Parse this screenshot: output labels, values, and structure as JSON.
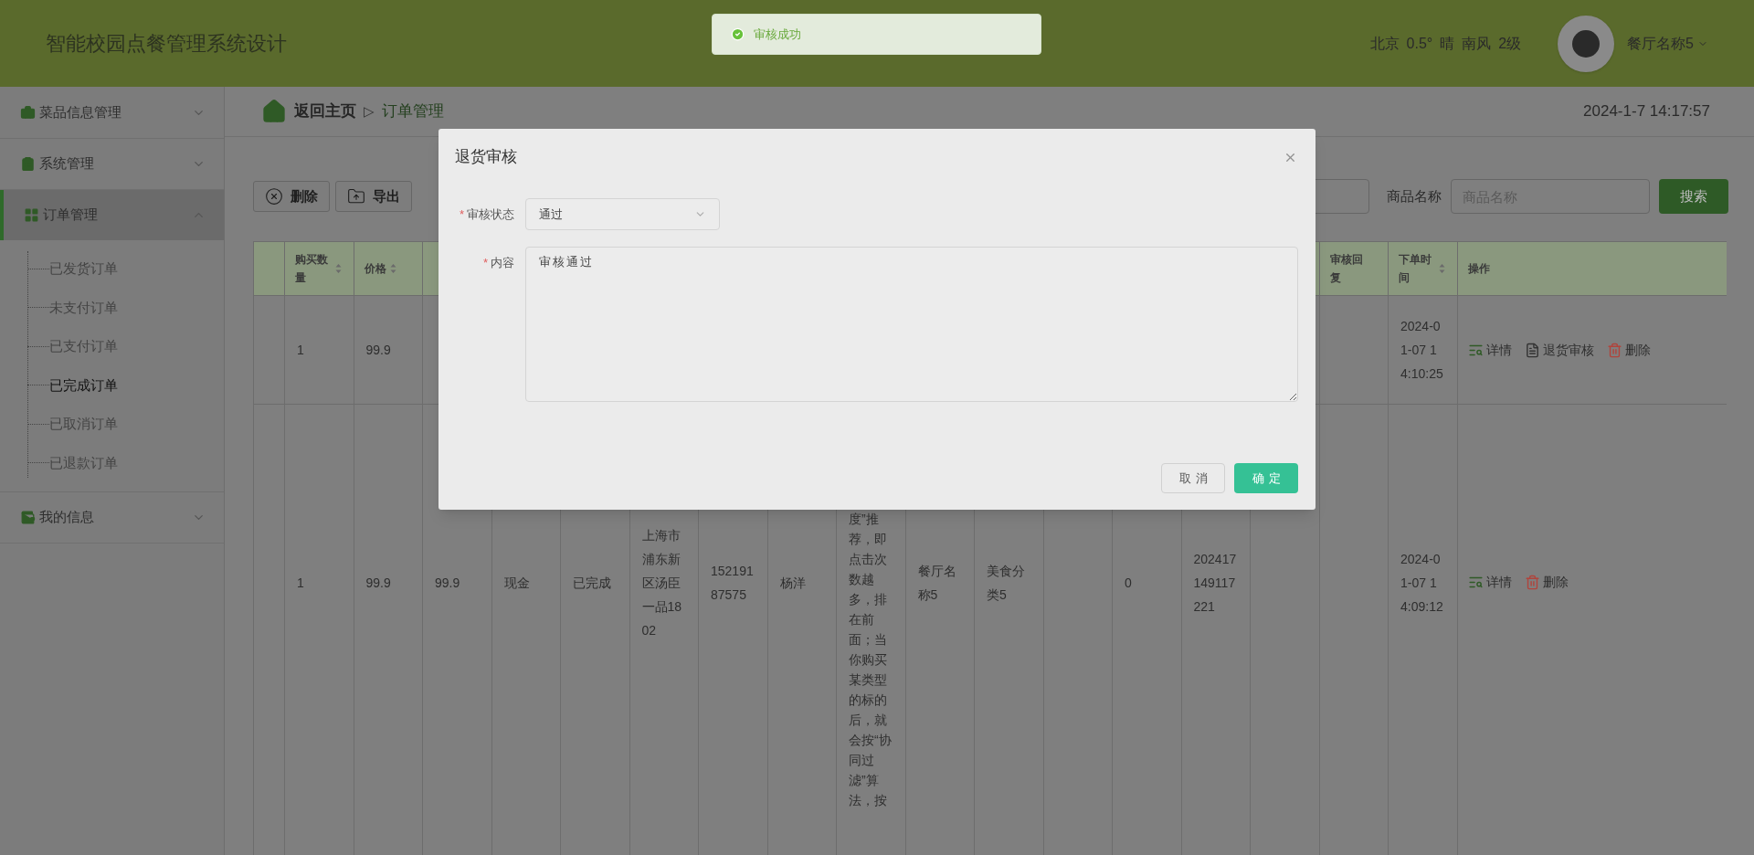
{
  "header": {
    "title": "智能校园点餐管理系统设计",
    "weather": [
      "北京",
      "0.5°",
      "晴",
      "南风",
      "2级"
    ],
    "user": "餐厅名称5"
  },
  "toast": {
    "text": "审核成功"
  },
  "sidebar": {
    "items": [
      {
        "label": "菜品信息管理",
        "expanded": false,
        "selected": false
      },
      {
        "label": "系统管理",
        "expanded": false,
        "selected": false
      },
      {
        "label": "订单管理",
        "expanded": true,
        "selected": true,
        "children": [
          {
            "label": "已发货订单",
            "selected": false
          },
          {
            "label": "未支付订单",
            "selected": false
          },
          {
            "label": "已支付订单",
            "selected": false
          },
          {
            "label": "已完成订单",
            "selected": true
          },
          {
            "label": "已取消订单",
            "selected": false
          },
          {
            "label": "已退款订单",
            "selected": false
          }
        ]
      },
      {
        "label": "我的信息",
        "expanded": false,
        "selected": false
      }
    ]
  },
  "breadcrumb": {
    "home": "返回主页",
    "separator": "▷",
    "current": "订单管理"
  },
  "clock": "2024-1-7 14:17:57",
  "toolbar": {
    "buttons": [
      {
        "kind": "delete",
        "label": "删除"
      },
      {
        "kind": "export",
        "label": "导出"
      }
    ]
  },
  "search": {
    "label": "商品名称",
    "placeholder": "商品名称",
    "button": "搜索"
  },
  "table": {
    "columns": [
      {
        "label": "购买数量",
        "sortable": true
      },
      {
        "label": "价格",
        "sortable": true
      },
      null,
      null,
      null,
      null,
      null,
      null,
      null,
      null,
      null,
      null,
      null,
      null,
      null,
      {
        "label": "审核回复",
        "sortable": false
      },
      {
        "label": "下单时间",
        "sortable": true
      }
    ],
    "actions_label": "操作",
    "rows": [
      {
        "cells": [
          "1",
          "99.9",
          null,
          null,
          null,
          null,
          null,
          null,
          null,
          null,
          null,
          null,
          null,
          null,
          null,
          null,
          "2024-01-07 14:10:25"
        ],
        "actions": [
          {
            "kind": "detail",
            "label": "详情"
          },
          {
            "kind": "review",
            "label": "退货审核"
          },
          {
            "kind": "delete",
            "label": "删除"
          }
        ]
      },
      {
        "cells": [
          "1",
          "99.9",
          "99.9",
          "现金",
          "已完成",
          "上海市浦东新区汤臣一品1802",
          "15219187575",
          "杨洋",
          "度”推荐，即点击次数越多，排在前面；当你购买某类型的标的后，就会按“协同过滤”算法，按",
          "餐厅名称5",
          "美食分类5",
          null,
          "0",
          "202417149117221",
          null,
          null,
          "2024-01-07 14:09:12"
        ],
        "actions": [
          {
            "kind": "detail",
            "label": "详情"
          },
          {
            "kind": "delete",
            "label": "删除"
          }
        ]
      }
    ]
  },
  "dialog": {
    "title": "退货审核",
    "required_mark": "*",
    "fields": [
      {
        "kind": "select",
        "label": "审核状态",
        "required": true,
        "value": "通过"
      },
      {
        "kind": "textarea",
        "label": "内容",
        "required": true,
        "value": "审核通过"
      }
    ],
    "buttons": [
      {
        "kind": "cancel",
        "label": "取消"
      },
      {
        "kind": "confirm",
        "label": "确定"
      }
    ]
  }
}
